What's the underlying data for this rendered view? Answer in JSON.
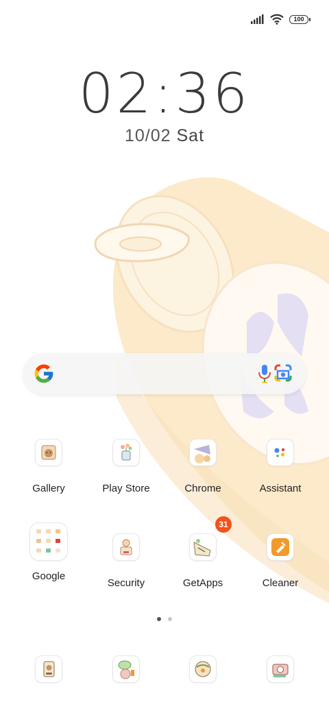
{
  "status_bar": {
    "signal_icon": "signal-bars-icon",
    "wifi_icon": "wifi-icon",
    "battery_level": "100"
  },
  "clock": {
    "time": "02:36",
    "date": "10/02",
    "day": "Sat"
  },
  "search_bar": {
    "logo_icon": "google-g-icon",
    "voice_icon": "microphone-icon",
    "lens_icon": "google-lens-icon"
  },
  "apps": [
    {
      "label": "Gallery",
      "icon": "gallery-icon"
    },
    {
      "label": "Play Store",
      "icon": "play-store-icon"
    },
    {
      "label": "Chrome",
      "icon": "chrome-icon"
    },
    {
      "label": "Assistant",
      "icon": "assistant-icon"
    },
    {
      "label": "Google",
      "icon": "google-folder-icon"
    },
    {
      "label": "Security",
      "icon": "security-icon"
    },
    {
      "label": "GetApps",
      "icon": "getapps-icon",
      "badge": "31"
    },
    {
      "label": "Cleaner",
      "icon": "cleaner-icon"
    }
  ],
  "page_indicator": {
    "pages": 2,
    "current": 1
  },
  "dock": [
    {
      "icon": "phone-icon"
    },
    {
      "icon": "messages-icon"
    },
    {
      "icon": "browser-icon"
    },
    {
      "icon": "camera-icon"
    }
  ],
  "colors": {
    "badge": "#f2521b",
    "wallpaper_can": "#fbe3b8",
    "wallpaper_text": "#dcd6ef"
  }
}
